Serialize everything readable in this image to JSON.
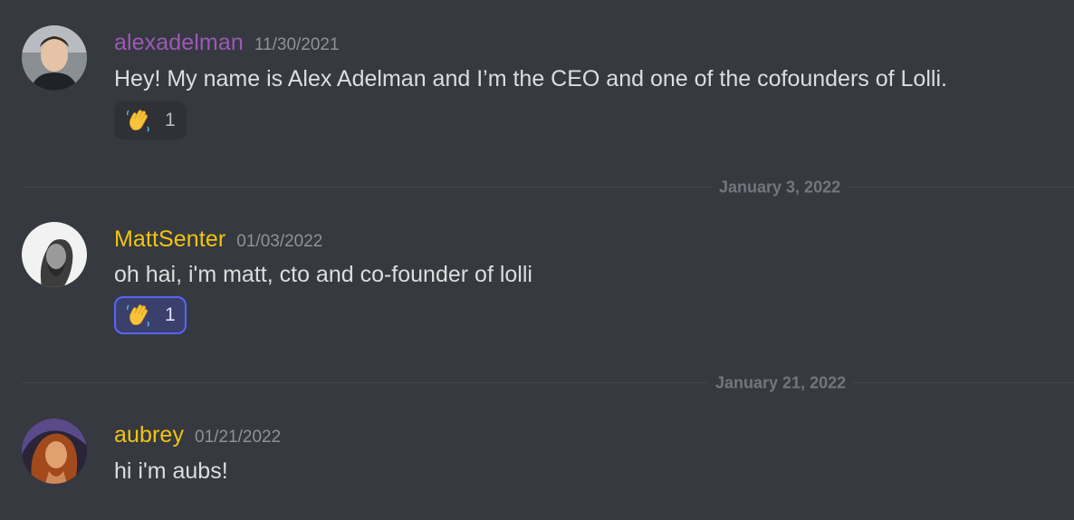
{
  "colors": {
    "background": "#36393f",
    "username_purple": "#9b59b6",
    "username_gold": "#f1c40f",
    "message_text": "#dcddde",
    "timestamp": "#8e9297",
    "divider": "#42454a",
    "reaction_active_border": "#5865f2"
  },
  "messages": [
    {
      "username": "alexadelman",
      "timestamp": "11/30/2021",
      "text": "Hey! My name is Alex Adelman and I’m the CEO and one of the cofounders of Lolli.",
      "reaction": {
        "emoji": "waving-hand-icon",
        "count": "1",
        "reacted_by_me": false
      }
    },
    {
      "username": "MattSenter",
      "timestamp": "01/03/2022",
      "text": "oh hai, i'm matt, cto and co-founder of lolli",
      "reaction": {
        "emoji": "waving-hand-icon",
        "count": "1",
        "reacted_by_me": true
      }
    },
    {
      "username": "aubrey",
      "timestamp": "01/21/2022",
      "text": "hi i'm aubs!"
    }
  ],
  "dividers": [
    {
      "label": "January 3, 2022"
    },
    {
      "label": "January 21, 2022"
    }
  ]
}
